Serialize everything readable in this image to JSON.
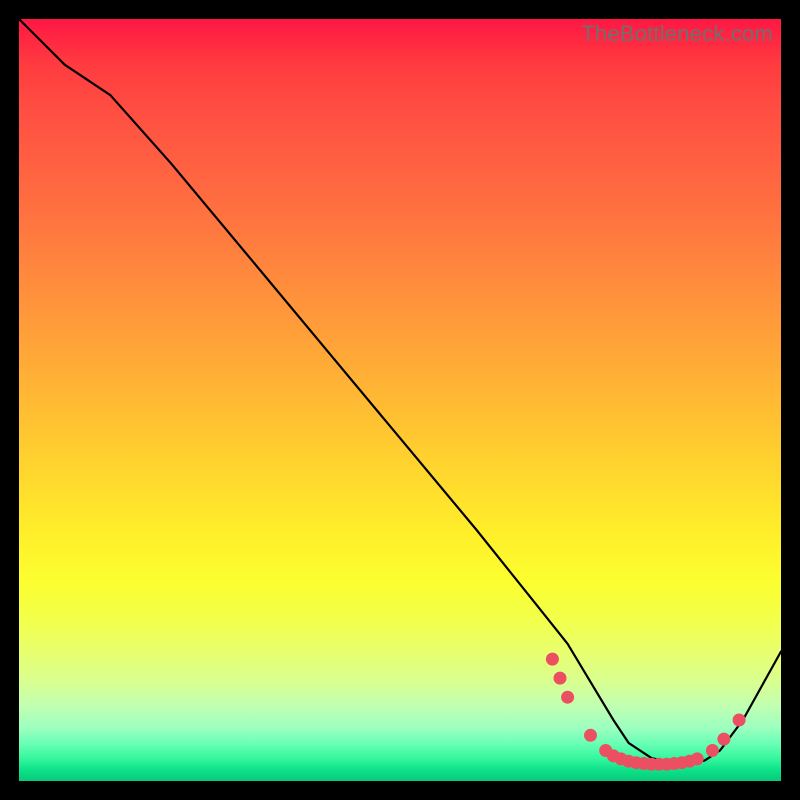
{
  "watermark": "TheBottleneck.com",
  "chart_data": {
    "type": "line",
    "title": "",
    "xlabel": "",
    "ylabel": "",
    "xlim": [
      0,
      100
    ],
    "ylim": [
      0,
      100
    ],
    "grid": false,
    "series": [
      {
        "name": "curve",
        "x": [
          0,
          6,
          12,
          20,
          30,
          40,
          50,
          60,
          68,
          72,
          75,
          78,
          80,
          83,
          86,
          88,
          90,
          92,
          95,
          100
        ],
        "y": [
          100,
          94,
          90,
          81,
          69,
          57,
          45,
          33,
          23,
          18,
          13,
          8,
          5,
          3,
          2.3,
          2.2,
          2.7,
          4,
          8,
          17
        ]
      }
    ],
    "markers": {
      "name": "bottom-cluster",
      "color": "#eb5062",
      "points": [
        {
          "x": 70,
          "y": 16
        },
        {
          "x": 71,
          "y": 13.5
        },
        {
          "x": 72,
          "y": 11
        },
        {
          "x": 75,
          "y": 6
        },
        {
          "x": 77,
          "y": 4
        },
        {
          "x": 78,
          "y": 3.3
        },
        {
          "x": 79,
          "y": 2.9
        },
        {
          "x": 80,
          "y": 2.6
        },
        {
          "x": 81,
          "y": 2.4
        },
        {
          "x": 82,
          "y": 2.3
        },
        {
          "x": 83,
          "y": 2.2
        },
        {
          "x": 84,
          "y": 2.2
        },
        {
          "x": 85,
          "y": 2.2
        },
        {
          "x": 86,
          "y": 2.3
        },
        {
          "x": 87,
          "y": 2.4
        },
        {
          "x": 88,
          "y": 2.6
        },
        {
          "x": 89,
          "y": 2.9
        },
        {
          "x": 91,
          "y": 4.0
        },
        {
          "x": 92.5,
          "y": 5.5
        },
        {
          "x": 94.5,
          "y": 8.0
        }
      ]
    }
  }
}
